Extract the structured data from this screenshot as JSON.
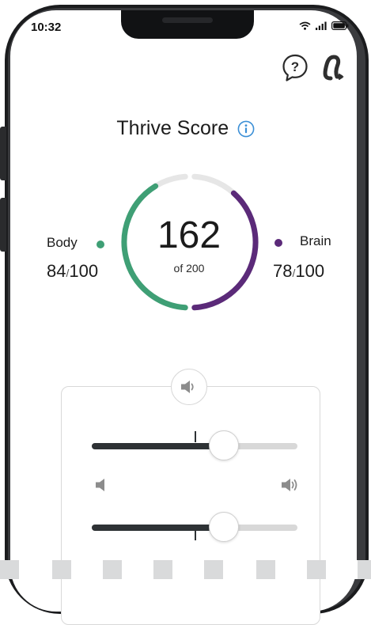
{
  "status_bar": {
    "time": "10:32"
  },
  "header": {
    "title": "Thrive Score"
  },
  "score": {
    "value": "162",
    "of_label": "of 200",
    "body": {
      "label": "Body",
      "value": "84",
      "max": "100",
      "fraction": 0.84,
      "color": "#3f9f75"
    },
    "brain": {
      "label": "Brain",
      "value": "78",
      "max": "100",
      "fraction": 0.78,
      "color": "#5b2a79"
    }
  },
  "colors": {
    "accent_info": "#3b8fd6",
    "track": "#e6e6e6",
    "slider_fill": "#2e3235"
  },
  "icons": {
    "help": "help-bubble-icon",
    "ear": "hearing-aid-icon",
    "info": "info-icon",
    "volume": "volume-icon",
    "volume_low": "volume-low-icon",
    "volume_high": "volume-high-icon"
  },
  "sound_controls": {
    "slider_1_level": 0.64,
    "slider_2_level": 0.64
  }
}
